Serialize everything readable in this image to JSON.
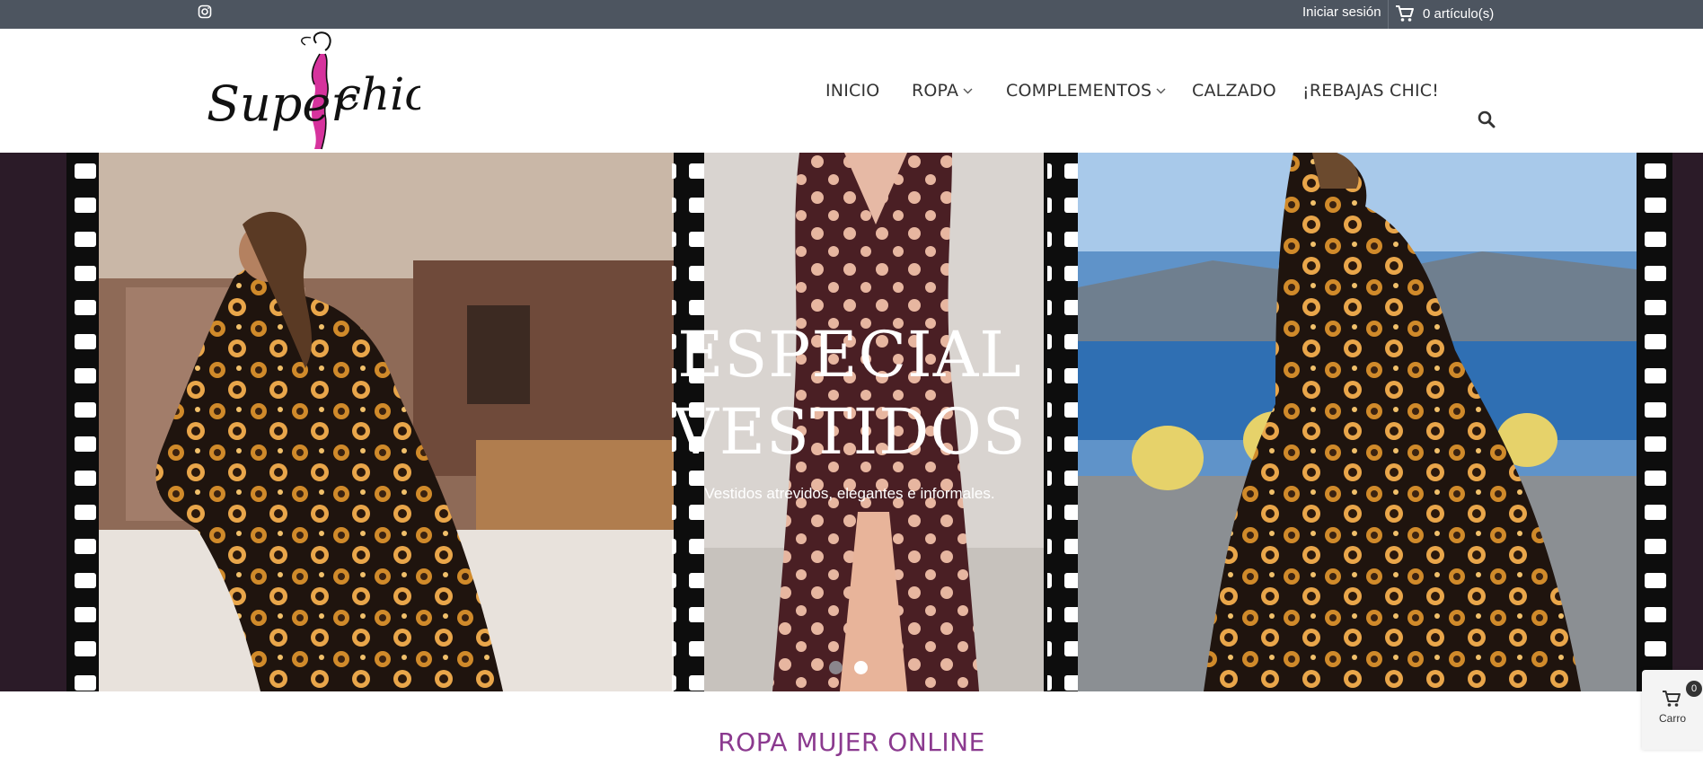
{
  "topbar": {
    "instagram_icon": "instagram-icon",
    "login_label": "Iniciar sesión",
    "cart_label": "0 artículo(s)",
    "cart_icon": "cart-icon"
  },
  "brand": {
    "logo_part1": "Super",
    "logo_part2": "chic",
    "accent_color": "#d6339d"
  },
  "nav": {
    "items": [
      {
        "label": "INICIO",
        "has_dropdown": false
      },
      {
        "label": "ROPA",
        "has_dropdown": true
      },
      {
        "label": "COMPLEMENTOS",
        "has_dropdown": true
      },
      {
        "label": "CALZADO",
        "has_dropdown": false
      },
      {
        "label": "¡REBAJAS CHIC!",
        "has_dropdown": false
      }
    ],
    "search_icon": "search-icon"
  },
  "hero": {
    "title_line1": "ESPECIAL",
    "title_line2": "VESTIDOS",
    "subtitle": "Vestidos atrevidos, elegantes e informales.",
    "slide_count": 2,
    "active_slide": 2
  },
  "section": {
    "title": "ROPA MUJER ONLINE",
    "title_color": "#8b3a8f"
  },
  "floating_cart": {
    "count": "0",
    "label": "Carro"
  }
}
